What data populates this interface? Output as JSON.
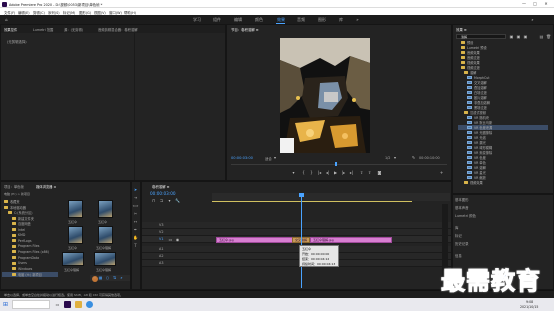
{
  "window": {
    "title": "Adobe Premiere Pro 2020 - D:\\视频\\0053\\新项目\\单色帧 *",
    "controls": [
      "—",
      "□",
      "✕"
    ]
  },
  "menu": [
    "文件(F)",
    "编辑(E)",
    "剪辑(C)",
    "序列(S)",
    "标记(M)",
    "图形(G)",
    "视图(V)",
    "窗口(W)",
    "帮助(H)"
  ],
  "workspaces": [
    "学习",
    "组件",
    "编辑",
    "颜色",
    "效果",
    "音频",
    "图形",
    "库"
  ],
  "active_workspace": "效果",
  "source_panel": {
    "tabs": [
      "效果控件",
      "Lumetri 范围",
      "源：(无剪辑)",
      "音频剪辑混合器：卷积溶解"
    ],
    "search_placeholder": "(无剪辑选择)"
  },
  "program_monitor": {
    "title": "节目：卷积溶解 ≡",
    "timecode_left": "00:00:03:00",
    "fit": "适合",
    "zoom": "1/2",
    "timecode_right": "00:00:10:00"
  },
  "effects_panel": {
    "title": "效果 ≡",
    "search_value": "溶解",
    "items": [
      {
        "label": "预设",
        "level": 1,
        "sel": false
      },
      {
        "label": "Lumetri 预设",
        "level": 1,
        "sel": false
      },
      {
        "label": "音频效果",
        "level": 1,
        "sel": false
      },
      {
        "label": "音频过渡",
        "level": 1,
        "sel": false
      },
      {
        "label": "视频效果",
        "level": 1,
        "sel": false
      },
      {
        "label": "视频过渡",
        "level": 1,
        "sel": false
      },
      {
        "label": "溶解",
        "level": 2,
        "sel": false
      },
      {
        "label": "MorphCut",
        "level": 3,
        "sel": false
      },
      {
        "label": "交叉溶解",
        "level": 3,
        "sel": false
      },
      {
        "label": "叠加溶解",
        "level": 3,
        "sel": false
      },
      {
        "label": "白场过渡",
        "level": 3,
        "sel": false
      },
      {
        "label": "胶片溶解",
        "level": 3,
        "sel": false
      },
      {
        "label": "非叠加溶解",
        "level": 3,
        "sel": false
      },
      {
        "label": "黑场过渡",
        "level": 3,
        "sel": false
      },
      {
        "label": "沉浸式视频",
        "level": 2,
        "sel": false
      },
      {
        "label": "VR 随机块",
        "level": 3,
        "sel": false
      },
      {
        "label": "VR 默比乌斯",
        "level": 3,
        "sel": false
      },
      {
        "label": "VR 色度泄漏",
        "level": 3,
        "sel": true
      },
      {
        "label": "VR 光圈擦除",
        "level": 3,
        "sel": false
      },
      {
        "label": "VR 光线",
        "level": 3,
        "sel": false
      },
      {
        "label": "VR 漏光",
        "level": 3,
        "sel": false
      },
      {
        "label": "VR 球形模糊",
        "level": 3,
        "sel": false
      },
      {
        "label": "VR 渐变擦除",
        "level": 3,
        "sel": false
      },
      {
        "label": "VR 色度",
        "level": 3,
        "sel": false
      },
      {
        "label": "VR 单色",
        "level": 3,
        "sel": false
      },
      {
        "label": "VR 溶解",
        "level": 3,
        "sel": false
      },
      {
        "label": "VR 星光",
        "level": 3,
        "sel": false
      },
      {
        "label": "VR 缩放",
        "level": 3,
        "sel": false
      },
      {
        "label": "视频效果",
        "level": 2,
        "sel": false
      }
    ]
  },
  "right_lower": [
    "基本图形",
    "基本声音",
    "Lumetri 颜色",
    "库",
    "标记",
    "历史记录",
    "信息"
  ],
  "project_panel": {
    "tabs": [
      "项目：单色帧",
      "媒体浏览器 ≡"
    ],
    "path": "电脑 (H:) > 新项目",
    "tree": [
      "收藏夹",
      "本地驱动器",
      "C:(系统分区)",
      "新建文件夹",
      "百度网盘",
      "Intel",
      "KMD",
      "PerfLogs",
      "Program Files",
      "Program Files (x86)",
      "ProgramData",
      "Users",
      "Windows",
      "电脑 (H:) 新项目"
    ],
    "thumbs": [
      {
        "label": "五红伞"
      },
      {
        "label": "五红伞"
      },
      {
        "label": "五红伞"
      },
      {
        "label": "五红伞理解"
      },
      {
        "label": "五红伞理解"
      },
      {
        "label": "五红伞理解"
      }
    ]
  },
  "timeline": {
    "tab": "卷积溶解 ≡",
    "timecode": "00:00:03:00",
    "tracks_v": [
      "V3",
      "V2",
      "V1"
    ],
    "tracks_a": [
      "A1",
      "A2",
      "A3"
    ],
    "clip1": "五红伞.jpg",
    "transition": "交叉溶解",
    "clip2": "五红伞理解.jpg",
    "tooltip": [
      "五红伞",
      "开始：00:00:00:00",
      "结束：00:00:04:12",
      "持续时间：00:00:04:13"
    ]
  },
  "statusbar": "单击以选择，或单击空白处并拖动以进行框选。使用 Shift、Alt 和 Ctrl 可获得其他选项。",
  "taskbar": {
    "time": "9:08",
    "date": "2021/10/15"
  },
  "watermark": "最需教育",
  "colors": {
    "accent": "#2d8ceb",
    "clip": "#d77ed1",
    "playhead": "#4aa3ff"
  }
}
